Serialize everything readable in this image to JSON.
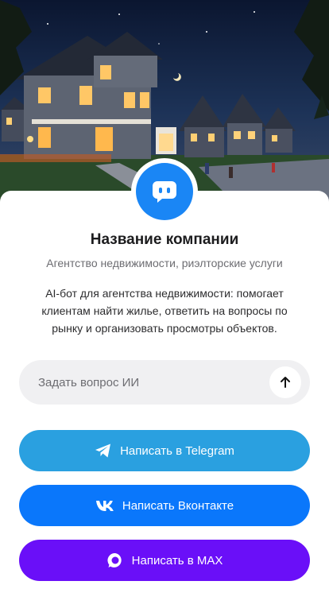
{
  "company": {
    "name": "Название компании",
    "subtitle": "Агентство недвижимости, риэлторские услуги",
    "description": "AI-бот для агентства недвижимости: помогает клиентам найти жилье, ответить на вопросы по рынку и организовать просмотры объектов."
  },
  "hero": {
    "image": "evening suburban houses",
    "icon": "chat-bot-icon"
  },
  "ask": {
    "placeholder": "Задать вопрос ИИ",
    "send_icon": "arrow-up-icon"
  },
  "buttons": {
    "telegram": {
      "label": "Написать в Telegram",
      "icon": "telegram-icon",
      "color": "#2aa0e0"
    },
    "vk": {
      "label": "Написать Вконтакте",
      "icon": "vk-icon",
      "color": "#0a77fb"
    },
    "max": {
      "label": "Написать в MAX",
      "icon": "max-icon",
      "color": "#6a0ff8"
    }
  },
  "colors": {
    "avatar": "#1a86f5",
    "field_bg": "#f0f0f2"
  }
}
